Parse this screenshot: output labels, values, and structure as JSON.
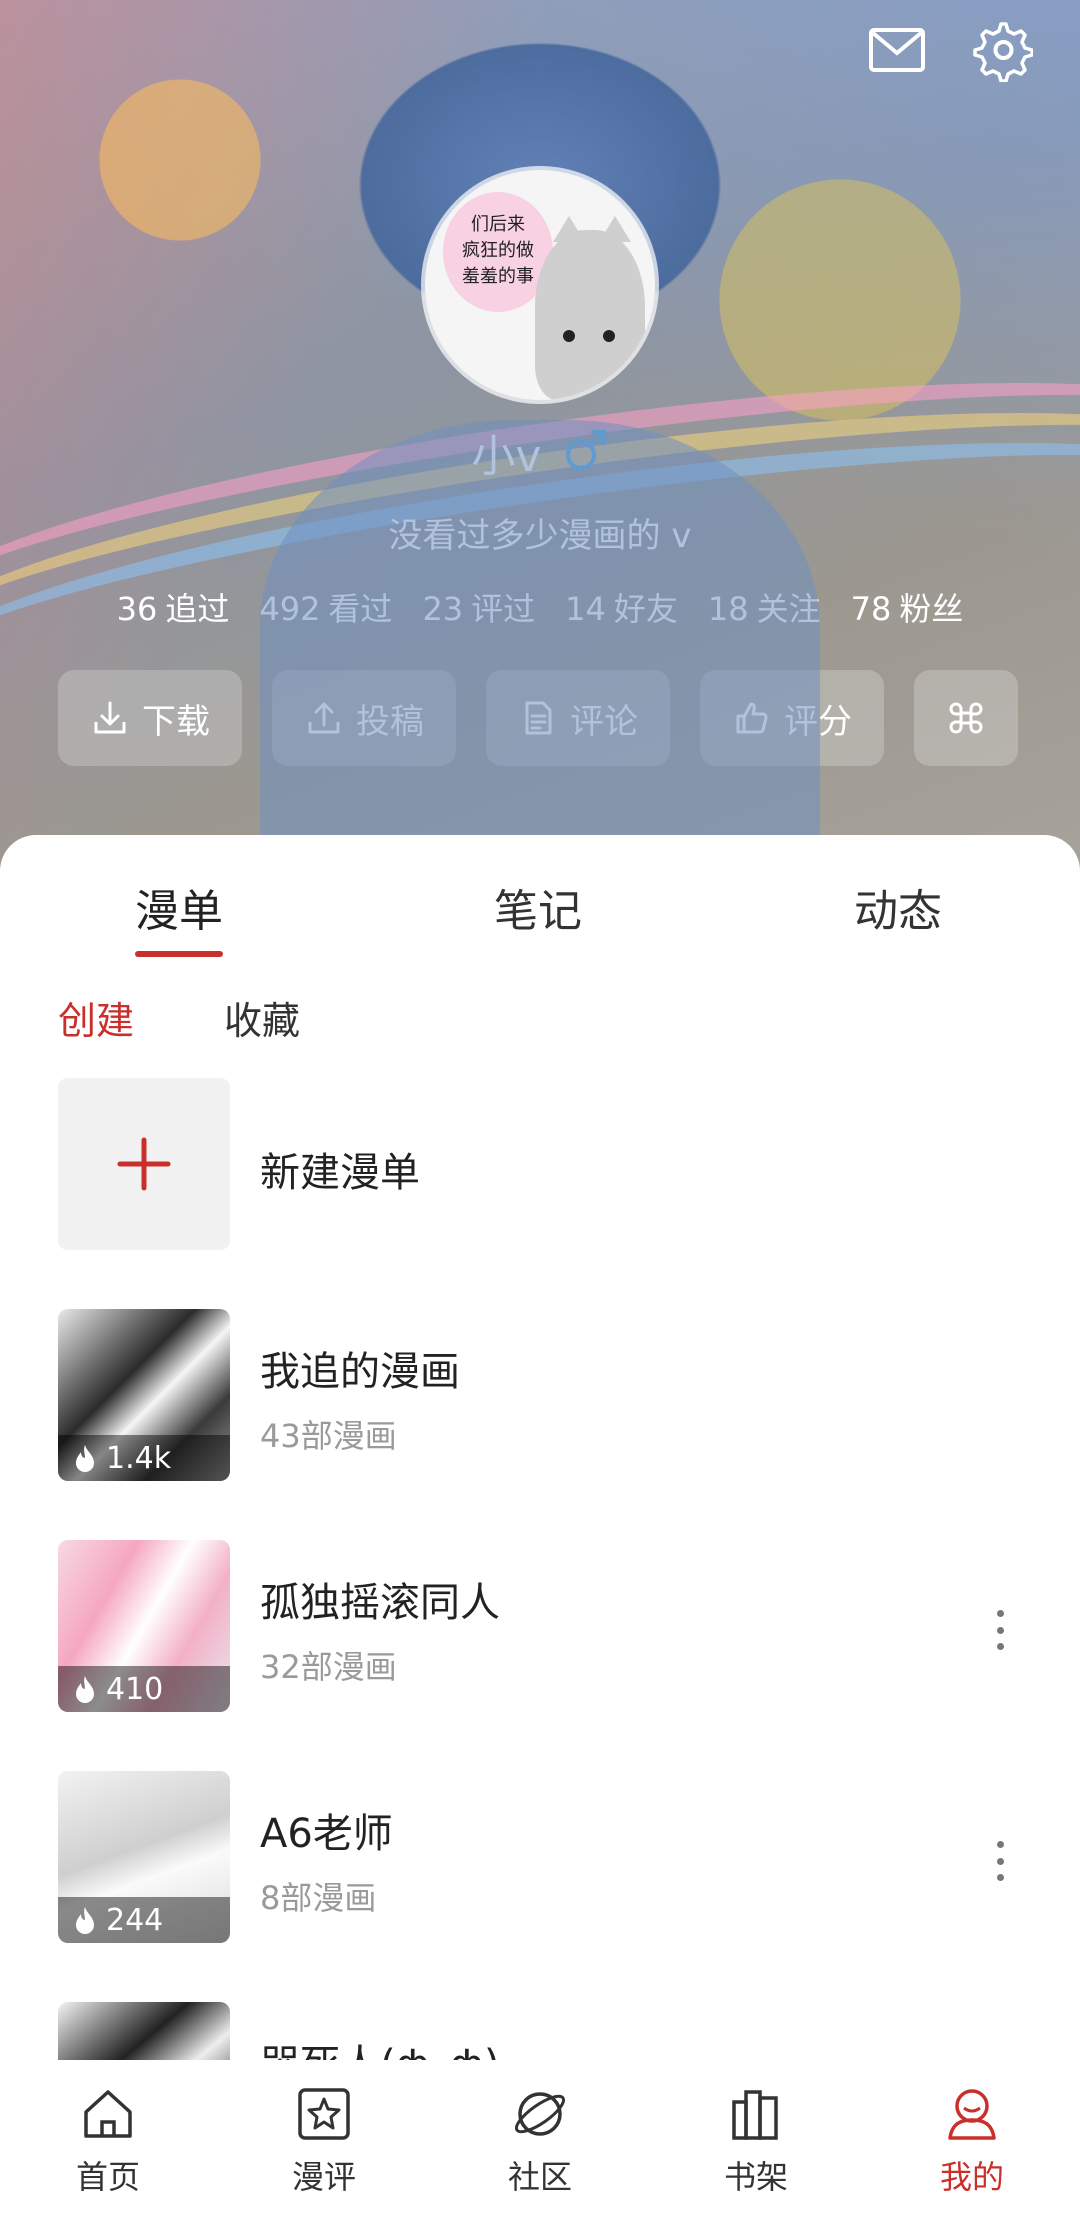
{
  "header": {
    "username": "小v",
    "gender_symbol": "♂",
    "bio": "没看过多少漫画的 v",
    "avatar_text": [
      "们后来",
      "疯狂的做",
      "羞羞的事"
    ],
    "stats": [
      {
        "num": "36",
        "label": "追过"
      },
      {
        "num": "492",
        "label": "看过"
      },
      {
        "num": "23",
        "label": "评过"
      },
      {
        "num": "14",
        "label": "好友"
      },
      {
        "num": "18",
        "label": "关注"
      },
      {
        "num": "78",
        "label": "粉丝"
      }
    ],
    "actions": [
      {
        "label": "下载",
        "icon": "download-icon"
      },
      {
        "label": "投稿",
        "icon": "upload-icon"
      },
      {
        "label": "评论",
        "icon": "document-icon"
      },
      {
        "label": "评分",
        "icon": "thumbs-up-icon"
      },
      {
        "label": "",
        "icon": "command-icon"
      }
    ]
  },
  "tabs": [
    "漫单",
    "笔记",
    "动态"
  ],
  "active_tab": "漫单",
  "subtabs": [
    "创建",
    "收藏"
  ],
  "active_subtab": "创建",
  "list": {
    "new_label": "新建漫单",
    "items": [
      {
        "title": "我追的漫画",
        "count": "43部漫画",
        "heat": "1.4k"
      },
      {
        "title": "孤独摇滚同人",
        "count": "32部漫画",
        "heat": "410"
      },
      {
        "title": "A6老师",
        "count": "8部漫画",
        "heat": "244"
      },
      {
        "title": "哭死人(ф_ф)",
        "count": "",
        "heat": ""
      }
    ]
  },
  "bottom_nav": [
    {
      "label": "首页",
      "icon": "home-icon"
    },
    {
      "label": "漫评",
      "icon": "star-icon"
    },
    {
      "label": "社区",
      "icon": "planet-icon"
    },
    {
      "label": "书架",
      "icon": "bookshelf-icon"
    },
    {
      "label": "我的",
      "icon": "user-icon"
    }
  ],
  "colors": {
    "accent": "#c9302c",
    "text": "#333333",
    "muted": "#9a9a9a",
    "gender": "#4aa8e8"
  }
}
